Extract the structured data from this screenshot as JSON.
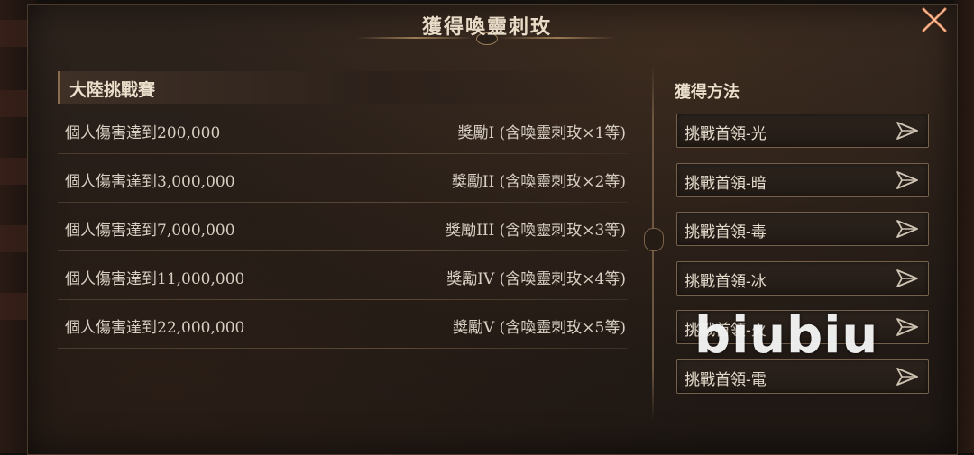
{
  "dialog": {
    "title": "獲得喚靈刺玫"
  },
  "rewards_section": {
    "title": "大陸挑戰賽",
    "rows": [
      {
        "requirement": "個人傷害達到200,000",
        "reward": "獎勵I (含喚靈刺玫×1等)"
      },
      {
        "requirement": "個人傷害達到3,000,000",
        "reward": "獎勵II (含喚靈刺玫×2等)"
      },
      {
        "requirement": "個人傷害達到7,000,000",
        "reward": "獎勵III (含喚靈刺玫×3等)"
      },
      {
        "requirement": "個人傷害達到11,000,000",
        "reward": "獎勵IV (含喚靈刺玫×4等)"
      },
      {
        "requirement": "個人傷害達到22,000,000",
        "reward": "獎勵V (含喚靈刺玫×5等)"
      }
    ]
  },
  "methods_section": {
    "title": "獲得方法",
    "buttons": [
      {
        "label": "挑戰首領-光"
      },
      {
        "label": "挑戰首領-暗"
      },
      {
        "label": "挑戰首領-毒"
      },
      {
        "label": "挑戰首領-冰"
      },
      {
        "label": "挑戰首領-火"
      },
      {
        "label": "挑戰首領-電"
      }
    ]
  },
  "watermark": "biubiu",
  "icons": {
    "close": "close-icon",
    "go": "go-arrow-icon"
  },
  "colors": {
    "panel_bg": "#241c17",
    "text": "#d8cfc2",
    "accent_gold": "#9a7a55",
    "close_orange": "#e3875a"
  }
}
